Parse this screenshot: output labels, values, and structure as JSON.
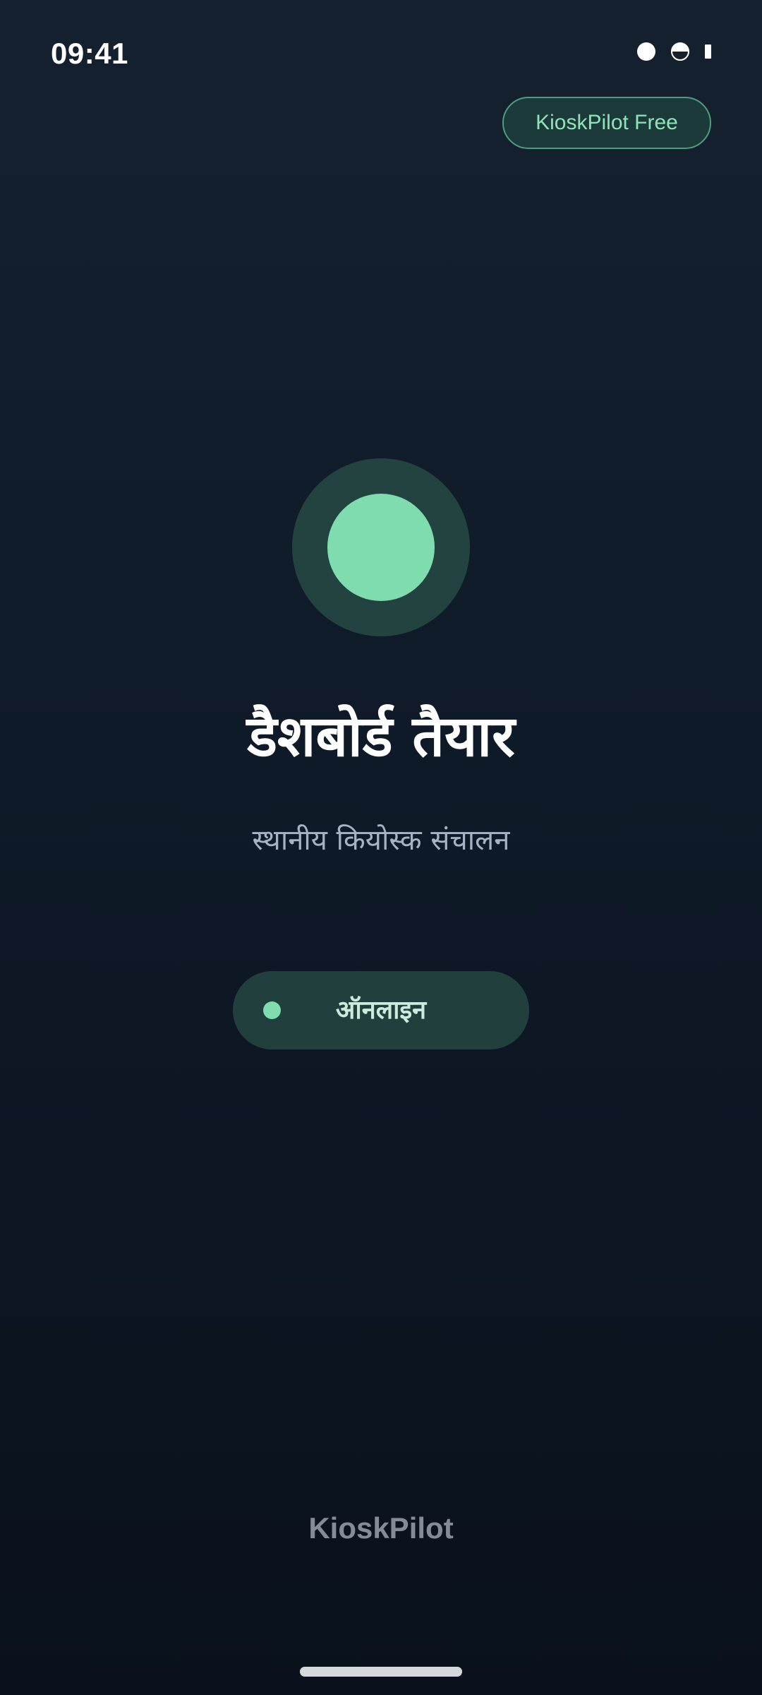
{
  "status_bar": {
    "time": "09:41",
    "icons": [
      "circle-status-icon",
      "half-circle-status-icon",
      "battery-bar-icon"
    ]
  },
  "header": {
    "plan_badge": "KioskPilot Free"
  },
  "main": {
    "status_icon": "status-indicator-icon",
    "title": "डैशबोर्ड तैयार",
    "subtitle": "स्थानीय कियोस्क संचालन",
    "status_pill": {
      "label": "ऑनलाइन",
      "dot_icon": "online-dot-icon"
    }
  },
  "footer": {
    "brand": "KioskPilot"
  },
  "colors": {
    "accent": "#7fdcae",
    "accent_dark": "#22433f",
    "background_top": "#15212f",
    "background_bottom": "#0a111c",
    "subtitle": "#a7b3c4"
  }
}
